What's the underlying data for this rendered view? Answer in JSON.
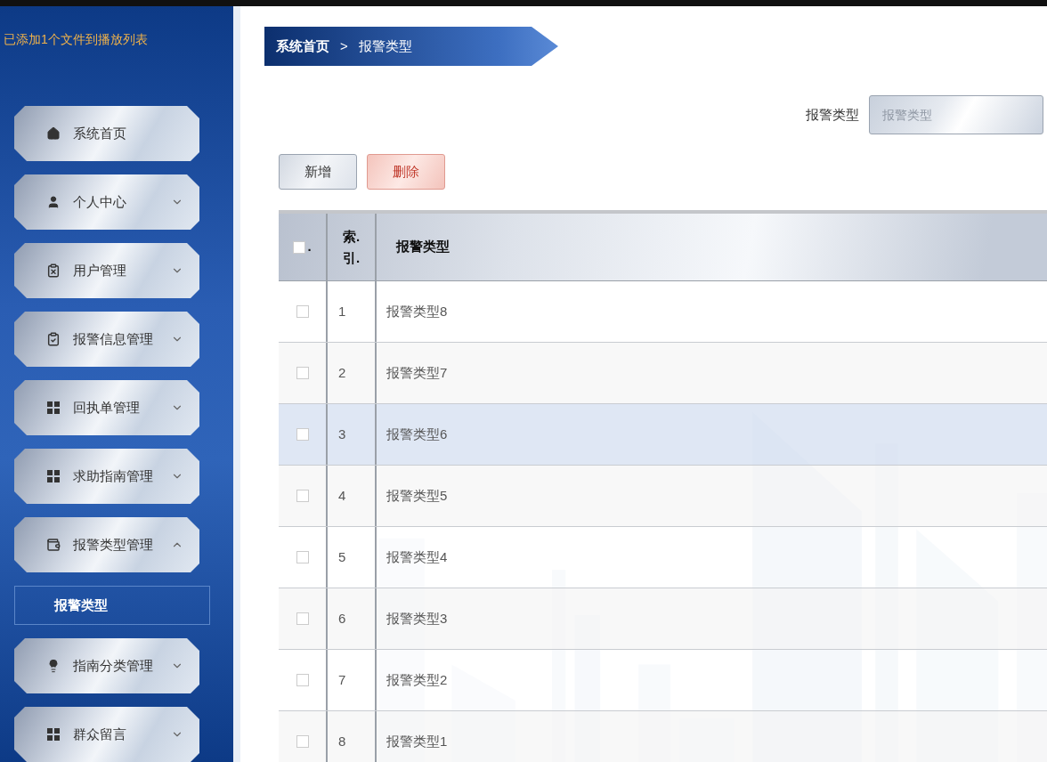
{
  "sidebar": {
    "notice": "已添加1个文件到播放列表",
    "items": [
      {
        "label": "系统首页",
        "kind": "link"
      },
      {
        "label": "个人中心",
        "kind": "menu",
        "expanded": false
      },
      {
        "label": "用户管理",
        "kind": "menu",
        "expanded": false
      },
      {
        "label": "报警信息管理",
        "kind": "menu",
        "expanded": false
      },
      {
        "label": "回执单管理",
        "kind": "menu",
        "expanded": false
      },
      {
        "label": "求助指南管理",
        "kind": "menu",
        "expanded": false
      },
      {
        "label": "报警类型管理",
        "kind": "menu",
        "expanded": true,
        "children": [
          {
            "label": "报警类型"
          }
        ]
      },
      {
        "label": "指南分类管理",
        "kind": "menu",
        "expanded": false
      },
      {
        "label": "群众留言",
        "kind": "menu",
        "expanded": false
      }
    ]
  },
  "breadcrumb": {
    "home": "系统首页",
    "separator": ">",
    "current": "报警类型"
  },
  "search": {
    "label": "报警类型",
    "placeholder": "报警类型"
  },
  "buttons": [
    {
      "label": "新增",
      "kind": "default"
    },
    {
      "label": "删除",
      "kind": "danger"
    }
  ],
  "table": {
    "columns": [
      ".",
      "索.引.",
      "报警类型"
    ],
    "all_checked": false,
    "rows": [
      {
        "index": "1",
        "name": "报警类型8",
        "checked": false,
        "selected": false
      },
      {
        "index": "2",
        "name": "报警类型7",
        "checked": false,
        "selected": false
      },
      {
        "index": "3",
        "name": "报警类型6",
        "checked": false,
        "selected": true
      },
      {
        "index": "4",
        "name": "报警类型5",
        "checked": false,
        "selected": false
      },
      {
        "index": "5",
        "name": "报警类型4",
        "checked": false,
        "selected": false
      },
      {
        "index": "6",
        "name": "报警类型3",
        "checked": false,
        "selected": false
      },
      {
        "index": "7",
        "name": "报警类型2",
        "checked": false,
        "selected": false
      },
      {
        "index": "8",
        "name": "报警类型1",
        "checked": false,
        "selected": false
      }
    ]
  }
}
